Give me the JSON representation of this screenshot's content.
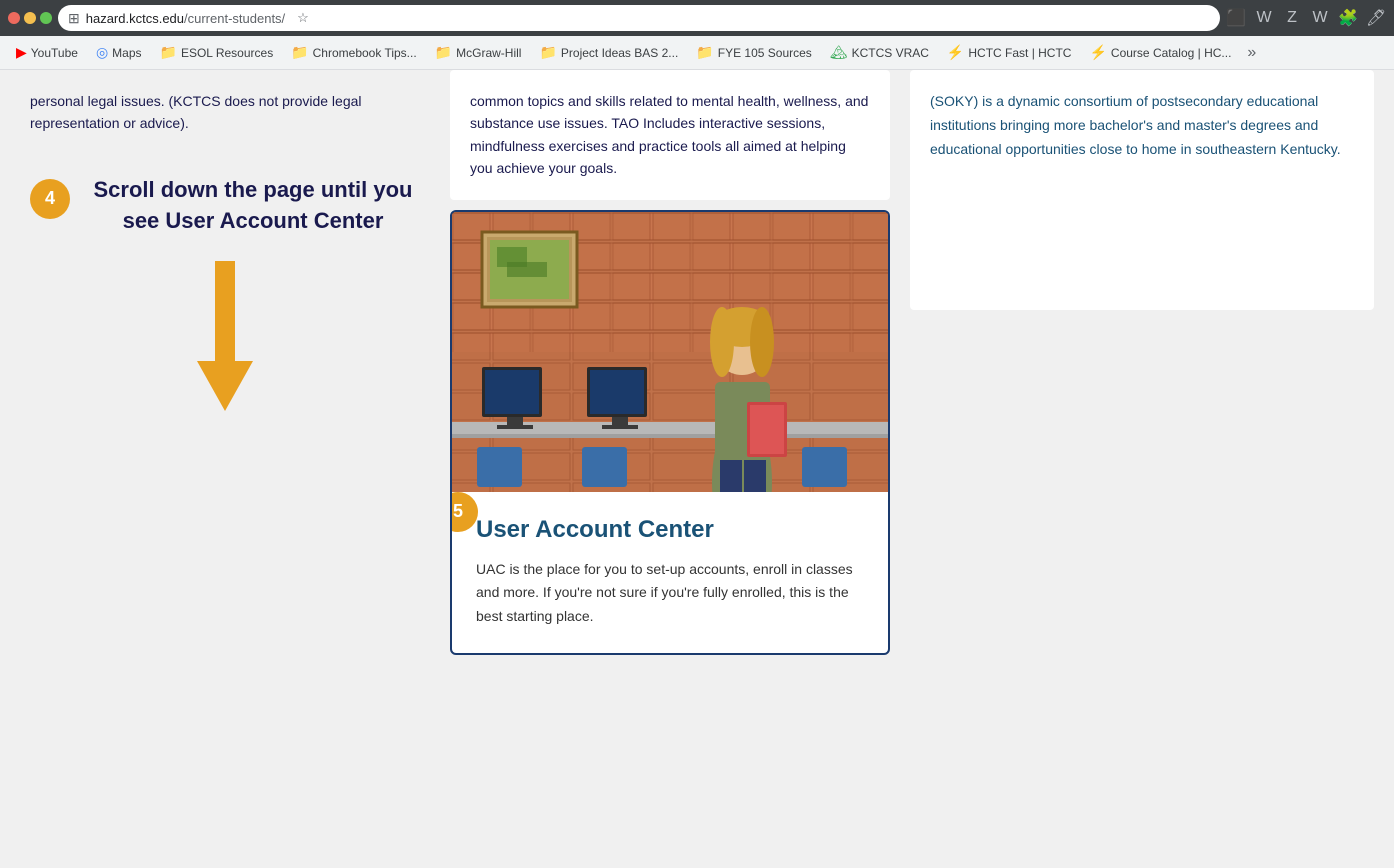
{
  "browser": {
    "url_prefix": "hazard.kctcs.edu",
    "url_path": "/current-students/",
    "grid_icon": "⊞",
    "star_icon": "☆"
  },
  "bookmarks": [
    {
      "id": "youtube",
      "label": "YouTube",
      "icon": "▶",
      "icon_type": "youtube"
    },
    {
      "id": "maps",
      "label": "Maps",
      "icon": "◉",
      "icon_type": "maps"
    },
    {
      "id": "esol",
      "label": "ESOL Resources",
      "icon": "📁",
      "icon_type": "folder"
    },
    {
      "id": "chromebook",
      "label": "Chromebook Tips...",
      "icon": "📁",
      "icon_type": "folder"
    },
    {
      "id": "mcgraw",
      "label": "McGraw-Hill",
      "icon": "📁",
      "icon_type": "folder"
    },
    {
      "id": "project",
      "label": "Project Ideas BAS 2...",
      "icon": "📁",
      "icon_type": "folder"
    },
    {
      "id": "fye",
      "label": "FYE 105 Sources",
      "icon": "📁",
      "icon_type": "folder"
    },
    {
      "id": "kctcs",
      "label": "KCTCS VRAC",
      "icon": "🏔",
      "icon_type": "mountain"
    },
    {
      "id": "hctc",
      "label": "HCTC Fast | HCTC",
      "icon": "⚡",
      "icon_type": "lightning"
    },
    {
      "id": "catalog",
      "label": "Course Catalog | HC...",
      "icon": "⚡",
      "icon_type": "lightning"
    }
  ],
  "left_panel": {
    "legal_text": "personal legal issues. (KCTCS does not provide legal representation or advice).",
    "step4_number": "4",
    "instruction": "Scroll down the page until you see User Account Center",
    "arrow_direction": "down"
  },
  "middle_top": {
    "tao_text": "common topics and skills related to mental health, wellness, and substance use issues. TAO Includes interactive sessions, mindfulness exercises and practice tools all aimed at helping you achieve your goals."
  },
  "uac_card": {
    "step5_number": "5",
    "title": "User Account Center",
    "description": "UAC is the place for you to set-up accounts, enroll in classes and more. If you're not sure if you're fully enrolled, this is the best starting place."
  },
  "right_panel": {
    "consortium_text": "(SOKY) is a dynamic consortium of postsecondary educational institutions bringing more bachelor's and master's degrees and educational opportunities close to home in southeastern Kentucky."
  }
}
